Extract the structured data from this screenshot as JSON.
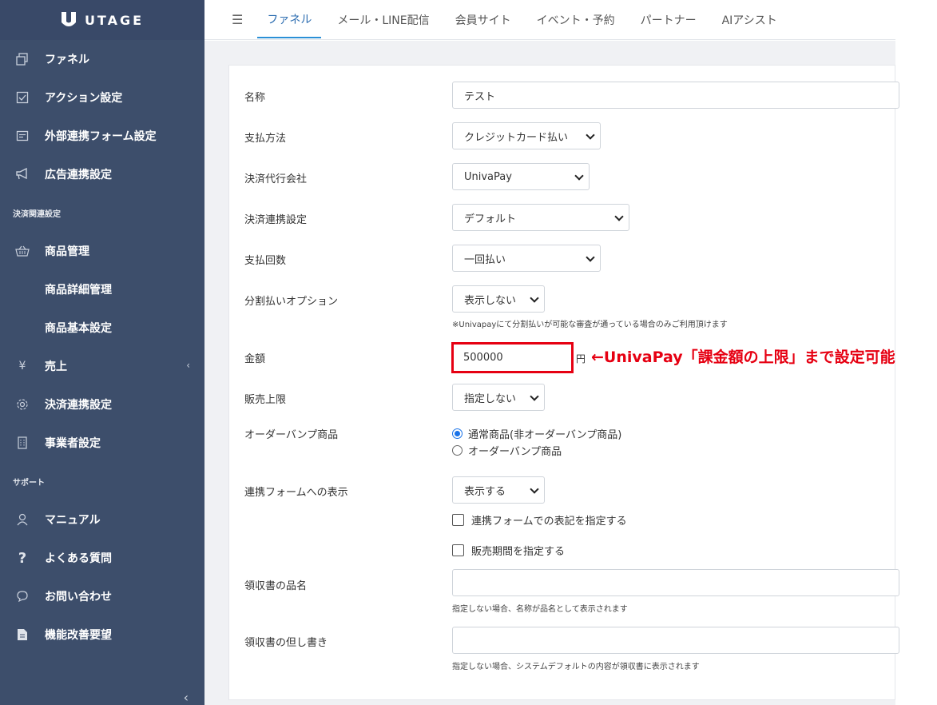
{
  "app": {
    "name": "UTAGE"
  },
  "sidebar": {
    "items": [
      {
        "label": "ファネル",
        "icon": "copy-icon"
      },
      {
        "label": "アクション設定",
        "icon": "checkbox-icon"
      },
      {
        "label": "外部連携フォーム設定",
        "icon": "form-icon"
      },
      {
        "label": "広告連携設定",
        "icon": "megaphone-icon"
      }
    ],
    "section_payment": "決済関連設定",
    "payment_items": [
      {
        "label": "商品管理",
        "icon": "basket-icon"
      },
      {
        "label": "商品詳細管理"
      },
      {
        "label": "商品基本設定"
      },
      {
        "label": "売上",
        "icon": "yen-icon"
      },
      {
        "label": "決済連携設定",
        "icon": "gear-icon"
      },
      {
        "label": "事業者設定",
        "icon": "building-icon"
      }
    ],
    "section_support": "サポート",
    "support_items": [
      {
        "label": "マニュアル",
        "icon": "user-icon"
      },
      {
        "label": "よくある質問",
        "icon": "question-icon"
      },
      {
        "label": "お問い合わせ",
        "icon": "chat-icon"
      },
      {
        "label": "機能改善要望",
        "icon": "document-icon"
      }
    ]
  },
  "topnav": {
    "tabs": [
      "ファネル",
      "メール・LINE配信",
      "会員サイト",
      "イベント・予約",
      "パートナー",
      "AIアシスト"
    ]
  },
  "form": {
    "name_label": "名称",
    "name_value": "テスト",
    "payment_method_label": "支払方法",
    "payment_method_value": "クレジットカード払い",
    "payment_company_label": "決済代行会社",
    "payment_company_value": "UnivaPay",
    "payment_link_label": "決済連携設定",
    "payment_link_value": "デフォルト",
    "payment_count_label": "支払回数",
    "payment_count_value": "一回払い",
    "installment_label": "分割払いオプション",
    "installment_value": "表示しない",
    "installment_help": "※Univapayにて分割払いが可能な審査が通っている場合のみご利用頂けます",
    "price_label": "金額",
    "price_value": "500000",
    "price_unit": "円",
    "annotation": "←UnivaPay「課金額の上限」まで設定可能",
    "sales_limit_label": "販売上限",
    "sales_limit_value": "指定しない",
    "order_bump_label": "オーダーバンプ商品",
    "order_bump_opt1": "通常商品(非オーダーバンプ商品)",
    "order_bump_opt2": "オーダーバンプ商品",
    "form_display_label": "連携フォームへの表示",
    "form_display_value": "表示する",
    "check_notation": "連携フォームでの表記を指定する",
    "check_period": "販売期間を指定する",
    "receipt_item_label": "領収書の品名",
    "receipt_item_help": "指定しない場合、名称が品名として表示されます",
    "receipt_note_label": "領収書の但し書き",
    "receipt_note_help": "指定しない場合、システムデフォルトの内容が領収書に表示されます"
  },
  "colors": {
    "sidebar": "#3d4e6b",
    "accent": "#2b8fd6",
    "annotation": "#e60012"
  }
}
